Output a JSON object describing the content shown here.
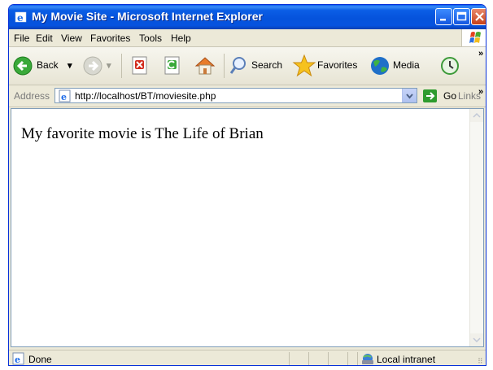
{
  "window": {
    "title": "My Movie Site - Microsoft Internet Explorer"
  },
  "menu": {
    "items": [
      "File",
      "Edit",
      "View",
      "Favorites",
      "Tools",
      "Help"
    ]
  },
  "toolbar": {
    "back_label": "Back",
    "search_label": "Search",
    "favorites_label": "Favorites",
    "media_label": "Media",
    "overflow": "»"
  },
  "address": {
    "label": "Address",
    "url": "http://localhost/BT/moviesite.php",
    "go_label": "Go",
    "links_label": "Links",
    "overflow": "»"
  },
  "page": {
    "text": "My favorite movie is The Life of Brian"
  },
  "status": {
    "text": "Done",
    "zone": "Local intranet"
  },
  "colors": {
    "titlebar": "#0553dc",
    "chrome": "#ece9d8",
    "go_green": "#2e9b2e"
  },
  "icons": [
    "ie-icon",
    "minimize-icon",
    "maximize-icon",
    "close-icon",
    "windows-logo",
    "back-arrow-icon",
    "forward-arrow-icon",
    "stop-icon",
    "refresh-icon",
    "home-icon",
    "search-icon",
    "favorites-star-icon",
    "media-icon",
    "history-icon",
    "page-icon",
    "go-arrow-icon",
    "intranet-icon"
  ]
}
